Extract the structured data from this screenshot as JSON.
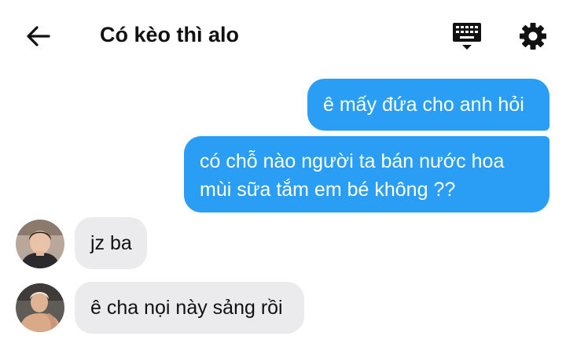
{
  "header": {
    "title": "Có kèo thì alo",
    "back_icon": "arrow-back-icon",
    "keyboard_icon": "keyboard-icon",
    "settings_icon": "gear-icon"
  },
  "messages": [
    {
      "direction": "sent",
      "text": "ê mấy đứa cho anh hỏi"
    },
    {
      "direction": "sent",
      "lines": [
        "có chỗ nào người ta bán nước hoa",
        "mùi sữa tắm em bé không ??"
      ]
    },
    {
      "direction": "received",
      "text": "jz ba"
    },
    {
      "direction": "received",
      "text": "ê cha nọi này sảng rồi"
    }
  ],
  "colors": {
    "sent_bubble": "#2a9df4",
    "received_bubble": "#ebebed",
    "text": "#111111"
  }
}
